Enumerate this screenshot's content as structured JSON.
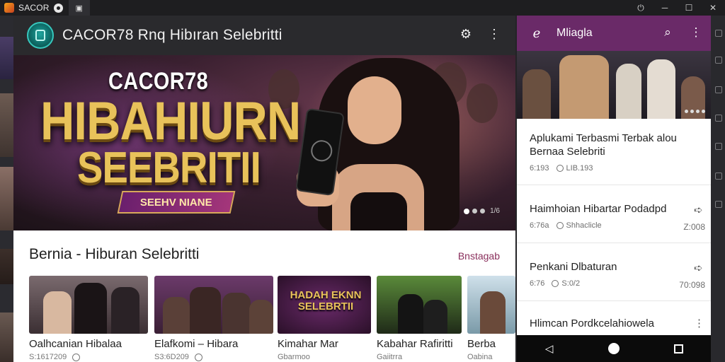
{
  "window": {
    "title": "SACOR",
    "controls": [
      "⏻",
      "─",
      "☐",
      "✕"
    ]
  },
  "appbar": {
    "title": "CACOR78 Rnq  Hibıran Selebritti"
  },
  "hero": {
    "brand": "CACOR78",
    "line1": "HIBAHIURN",
    "line2": "SEEBRITII",
    "ribbon": "SEEHV NIANE",
    "counter": "1/6"
  },
  "section": {
    "title": "Bernia - Hiburan Selebritti",
    "link": "Bnstagab"
  },
  "cards": [
    {
      "title": "Oalhcanian Hibalaa",
      "meta": "S:1617209",
      "img_text": ""
    },
    {
      "title": "Elafkomi – Hibara",
      "meta": "S3:6D209",
      "img_text": ""
    },
    {
      "title": "Kimahar Mar",
      "meta": "Gbarmoo",
      "img_text": "HADAH EKNN SELEBRTII"
    },
    {
      "title": "Kabahar Rafiritti",
      "meta": "Gaiitrra",
      "img_text": ""
    },
    {
      "title": "Berba",
      "meta": "Oabina",
      "img_text": ""
    }
  ],
  "panel": {
    "title": "Mliagla",
    "items": [
      {
        "title": "Aplukami Terbasmi Terbak alou Bernaa Selebriti",
        "date": "6:193",
        "views": "LIB.193",
        "duration": "",
        "action": ""
      },
      {
        "title": "Haimhoian Hibartar Podadpd",
        "date": "6:76a",
        "views": "Shhaclicle",
        "duration": "Z:008",
        "action": "share"
      },
      {
        "title": "Penkani Dlbaturan",
        "date": "6:76",
        "views": "S:0/2",
        "duration": "70:098",
        "action": "share"
      },
      {
        "title": "Hlimcan Pordkcelahiowela",
        "date": "",
        "views": "",
        "duration": "",
        "action": "more"
      }
    ]
  },
  "colors": {
    "panel_bar": "#6a2a68",
    "gold_text": "#e8c25a",
    "link": "#8a2f5c"
  },
  "icons": {
    "settings": "gear-icon",
    "more": "more-vert-icon",
    "search": "search-icon",
    "back": "back-icon",
    "share": "share-icon"
  }
}
